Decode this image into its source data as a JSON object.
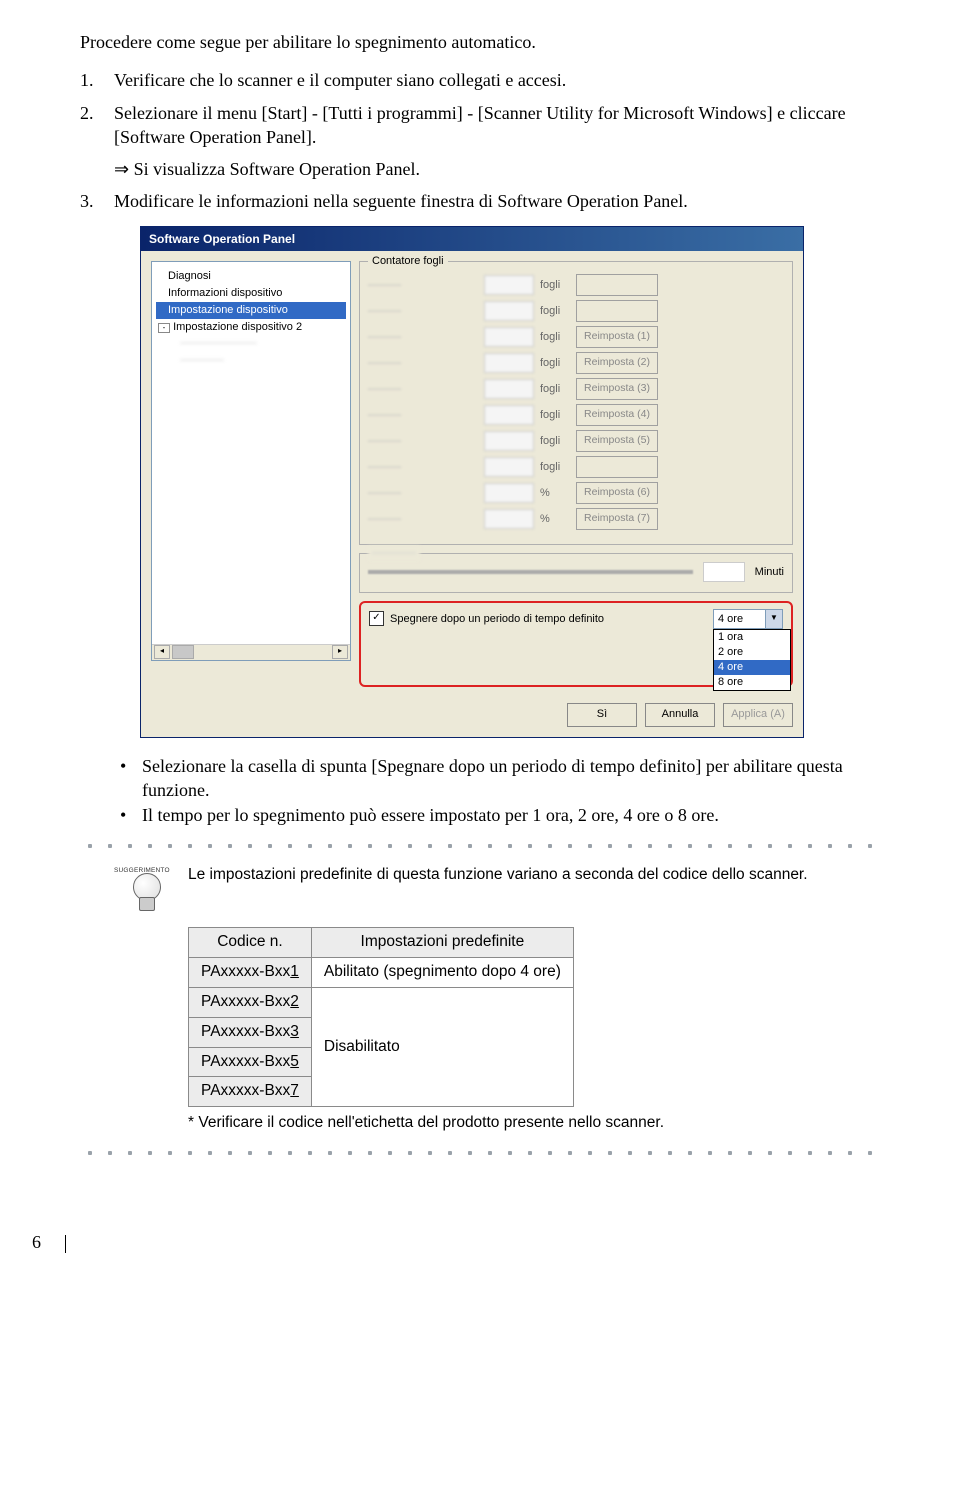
{
  "intro": "Procedere come segue per abilitare lo spegnimento automatico.",
  "steps": [
    {
      "num": "1.",
      "text": "Verificare che lo scanner e il computer siano collegati e accesi."
    },
    {
      "num": "2.",
      "text": "Selezionare il menu [Start] - [Tutti i programmi] - [Scanner Utility for Microsoft Windows] e cliccare [Software Operation Panel].",
      "result": "Si visualizza Software Operation Panel."
    },
    {
      "num": "3.",
      "text": "Modificare le informazioni nella seguente finestra di Software Operation Panel."
    }
  ],
  "sop": {
    "title": "Software Operation Panel",
    "tree": {
      "items": [
        "Diagnosi",
        "Informazioni dispositivo",
        "Impostazione dispositivo",
        "Impostazione dispositivo 2"
      ],
      "blurred": [
        "—",
        "—"
      ]
    },
    "fieldset_legend": "Contatore fogli",
    "rows": [
      {
        "unit": "fogli",
        "btn": ""
      },
      {
        "unit": "fogli",
        "btn": ""
      },
      {
        "unit": "fogli",
        "btn": "Reimposta (1)"
      },
      {
        "unit": "fogli",
        "btn": "Reimposta (2)"
      },
      {
        "unit": "fogli",
        "btn": "Reimposta (3)"
      },
      {
        "unit": "fogli",
        "btn": "Reimposta (4)"
      },
      {
        "unit": "fogli",
        "btn": "Reimposta (5)"
      },
      {
        "unit": "fogli",
        "btn": ""
      },
      {
        "unit": "%",
        "btn": "Reimposta (6)"
      },
      {
        "unit": "%",
        "btn": "Reimposta (7)"
      }
    ],
    "minuti_label": "Minuti",
    "checkbox_label": "Spegnere dopo un periodo di tempo definito",
    "dd_value": "4 ore",
    "dd_options": [
      "1 ora",
      "2 ore",
      "4 ore",
      "8 ore"
    ],
    "buttons": {
      "ok": "Sì",
      "cancel": "Annulla",
      "apply": "Applica (A)"
    }
  },
  "bullets": [
    "Selezionare la casella di spunta [Spegnare dopo un periodo di tempo definito] per abilitare questa funzione.",
    "Il tempo per lo spegnimento può essere impostato per 1 ora, 2 ore, 4 ore o 8 ore."
  ],
  "tip": {
    "label": "SUGGERIMENTO",
    "text": "Le impostazioni predefinite di questa funzione variano a seconda del codice dello scanner.",
    "footnote": "* Verificare il codice nell'etichetta del prodotto presente nello scanner."
  },
  "table": {
    "head": [
      "Codice n.",
      "Impostazioni predefinite"
    ],
    "row1": {
      "code": "PAxxxxx-Bxx1",
      "val": "Abilitato (spegnimento dopo 4 ore)"
    },
    "codes_disabled": [
      "PAxxxxx-Bxx2",
      "PAxxxxx-Bxx3",
      "PAxxxxx-Bxx5",
      "PAxxxxx-Bxx7"
    ],
    "disabled_val": "Disabilitato"
  },
  "page_number": "6"
}
